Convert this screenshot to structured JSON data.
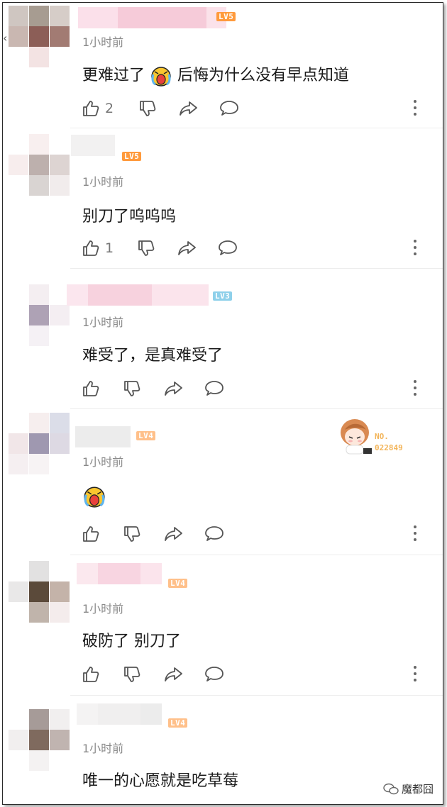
{
  "comments": [
    {
      "level": "LV5",
      "time": "1小时前",
      "text_before": "更难过了",
      "text_after": "后悔为什么没有早点知道",
      "likes": "2"
    },
    {
      "level": "LV5",
      "time": "1小时前",
      "text": "别刀了呜呜呜",
      "likes": "1"
    },
    {
      "level": "LV3",
      "time": "1小时前",
      "text": "难受了，是真难受了",
      "likes": ""
    },
    {
      "level": "LV4",
      "time": "1小时前",
      "text": "",
      "likes": ""
    },
    {
      "level": "LV4",
      "time": "1小时前",
      "text": "破防了 别刀了",
      "likes": ""
    },
    {
      "level": "LV4",
      "time": "1小时前",
      "text": "唯一的心愿就是吃草莓",
      "likes": ""
    }
  ],
  "fan_badge": {
    "label": "NO.",
    "number": "022849"
  },
  "watermark": "魔都囧",
  "colors": {
    "level_orange": "#ff9a3c",
    "level_peach": "#ffc08a",
    "level_blue": "#8ed0ea"
  }
}
